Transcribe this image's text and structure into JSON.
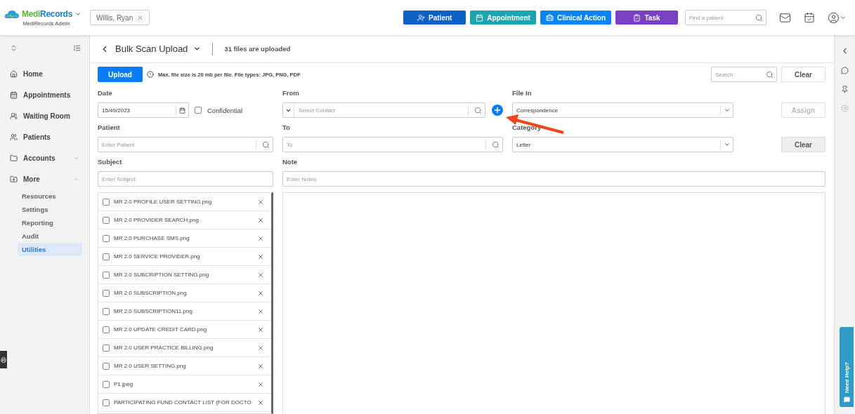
{
  "brand": {
    "name_parts": [
      "Medi",
      "Records"
    ],
    "subtitle": "MediRecords Admin"
  },
  "patient_tag": {
    "label": "Willis, Ryan"
  },
  "header_actions": [
    {
      "label": "Patient",
      "color": "#0b62c4",
      "kind": "patient"
    },
    {
      "label": "Appointment",
      "color": "#1ea3b0",
      "kind": "appointment"
    },
    {
      "label": "Clinical Action",
      "color": "#0a84f0",
      "kind": "clinical"
    },
    {
      "label": "Task",
      "color": "#7b3fc2",
      "kind": "task"
    }
  ],
  "patient_search": {
    "placeholder": "Find a patient"
  },
  "sidebar": {
    "items": [
      {
        "label": "Home",
        "kind": "home"
      },
      {
        "label": "Appointments",
        "kind": "calendar"
      },
      {
        "label": "Waiting Room",
        "kind": "waiting"
      },
      {
        "label": "Patients",
        "kind": "patients"
      },
      {
        "label": "Accounts",
        "kind": "accounts",
        "expanded": false
      },
      {
        "label": "More",
        "kind": "more",
        "expanded": true,
        "children": [
          {
            "label": "Resources",
            "selected": false
          },
          {
            "label": "Settings",
            "selected": false
          },
          {
            "label": "Reporting",
            "selected": false
          },
          {
            "label": "Audit",
            "selected": false
          },
          {
            "label": "Utilities",
            "selected": true
          }
        ]
      }
    ]
  },
  "page": {
    "title": "Bulk Scan Upload",
    "status": "31 files are uploaded"
  },
  "toolbar": {
    "upload_button": "Upload",
    "info": "Max. file size is 20 mb per file. File types: JPG, PNG, PDF",
    "search": {
      "placeholder": "Search"
    },
    "clear_button": "Clear"
  },
  "form": {
    "date": {
      "label": "Date",
      "value": "15/49/2023"
    },
    "confidential": {
      "label": "Confidential",
      "checked": false
    },
    "from": {
      "label": "From",
      "placeholder": "Select Contact"
    },
    "file_in": {
      "label": "File In",
      "value": "Correspondence"
    },
    "assign_button": {
      "label": "Assign",
      "disabled": true
    },
    "patient": {
      "label": "Patient",
      "placeholder": "Enter Patient"
    },
    "to": {
      "label": "To",
      "placeholder": "To"
    },
    "category": {
      "label": "Category",
      "value": "Letter"
    },
    "clear_button": {
      "label": "Clear",
      "disabled": false
    },
    "subject": {
      "label": "Subject",
      "placeholder": "Enter Subject"
    },
    "note": {
      "label": "Note",
      "placeholder": "Enter Notes"
    }
  },
  "files": [
    {
      "name": "MR 2.0 PROFILE USER SETTING.png",
      "checked": false
    },
    {
      "name": "MR 2.0 PROVIDER SEARCH.png",
      "checked": false
    },
    {
      "name": "MR 2.0 PURCHASE SMS.png",
      "checked": false
    },
    {
      "name": "MR 2.0 SERVICE PROVIDER.png",
      "checked": false
    },
    {
      "name": "MR 2.0 SUBCRIPTION SETTING.png",
      "checked": false
    },
    {
      "name": "MR 2.0 SUBSCRIPTION.png",
      "checked": false
    },
    {
      "name": "MR 2.0 SUBSCRIPTION11.png",
      "checked": false
    },
    {
      "name": "MR 2.0 UPDATE CREDIT CARD.png",
      "checked": false
    },
    {
      "name": "MR 2.0 USER PRACTICE BILLING.png",
      "checked": false
    },
    {
      "name": "MR 2.0 USER SETTING.png",
      "checked": false
    },
    {
      "name": "P1.jpeg",
      "checked": false
    },
    {
      "name": "PARTICIPATING FUND CONTACT LIST (FOR DOCTO",
      "checked": false
    }
  ],
  "help_tab": {
    "label": "Need Help?"
  }
}
